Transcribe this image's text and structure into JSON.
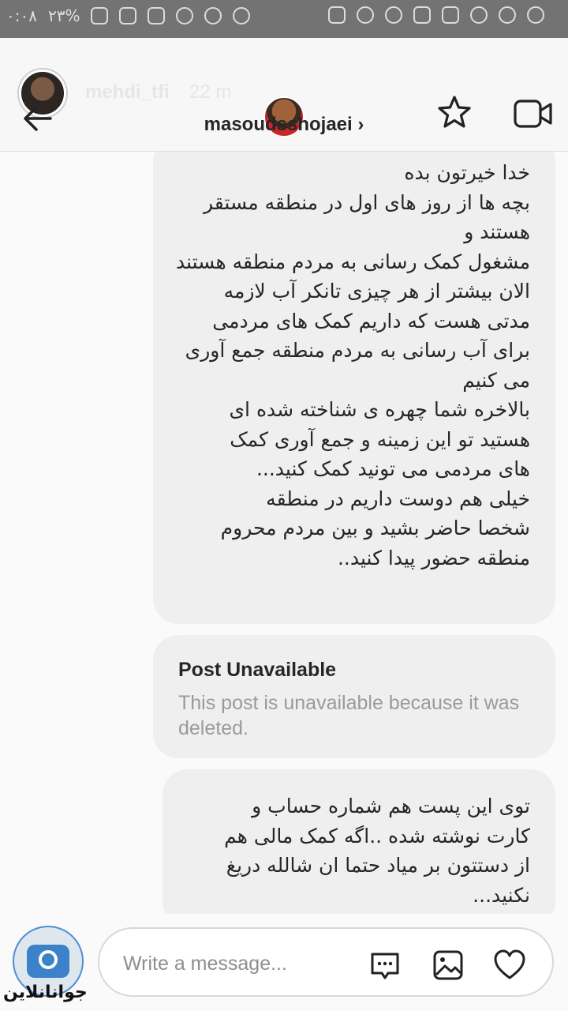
{
  "status_bar": {
    "left_text": "۰:۰۸",
    "battery_text": "۲۳%"
  },
  "story": {
    "username": "mehdi_tfi",
    "time": "22 m"
  },
  "chat": {
    "title": "masoudsshojaei",
    "title_chevron": "›"
  },
  "messages": {
    "first": "خدا خیرتون بده\nبچه ها از روز های اول در منطقه مستقر هستند و\nمشغول کمک رسانی به مردم منطقه هستند\nالان بیشتر از هر چیزی تانکر آب لازمه\nمدتی هست که داریم کمک های مردمی\nبرای آب رسانی به مردم منطقه جمع آوری می کنیم\nبالاخره شما چهره ی شناخته شده ای\nهستید تو این زمینه و جمع آوری کمک\nهای مردمی می تونید کمک کنید...\nخیلی هم دوست داریم در منطقه\nشخصا حاضر بشید و بین مردم محروم\nمنطقه حضور پیدا کنید..",
    "post_title": "Post Unavailable",
    "post_desc": "This post is unavailable because it was deleted.",
    "second": "توی این پست هم شماره حساب و\nکارت نوشته شده ..اگه کمک مالی هم\nاز دستتون بر میاد حتما ان شالله دریغ\nنکنید..."
  },
  "composer": {
    "placeholder": "Write a message..."
  },
  "watermark": "جوانانلاین"
}
